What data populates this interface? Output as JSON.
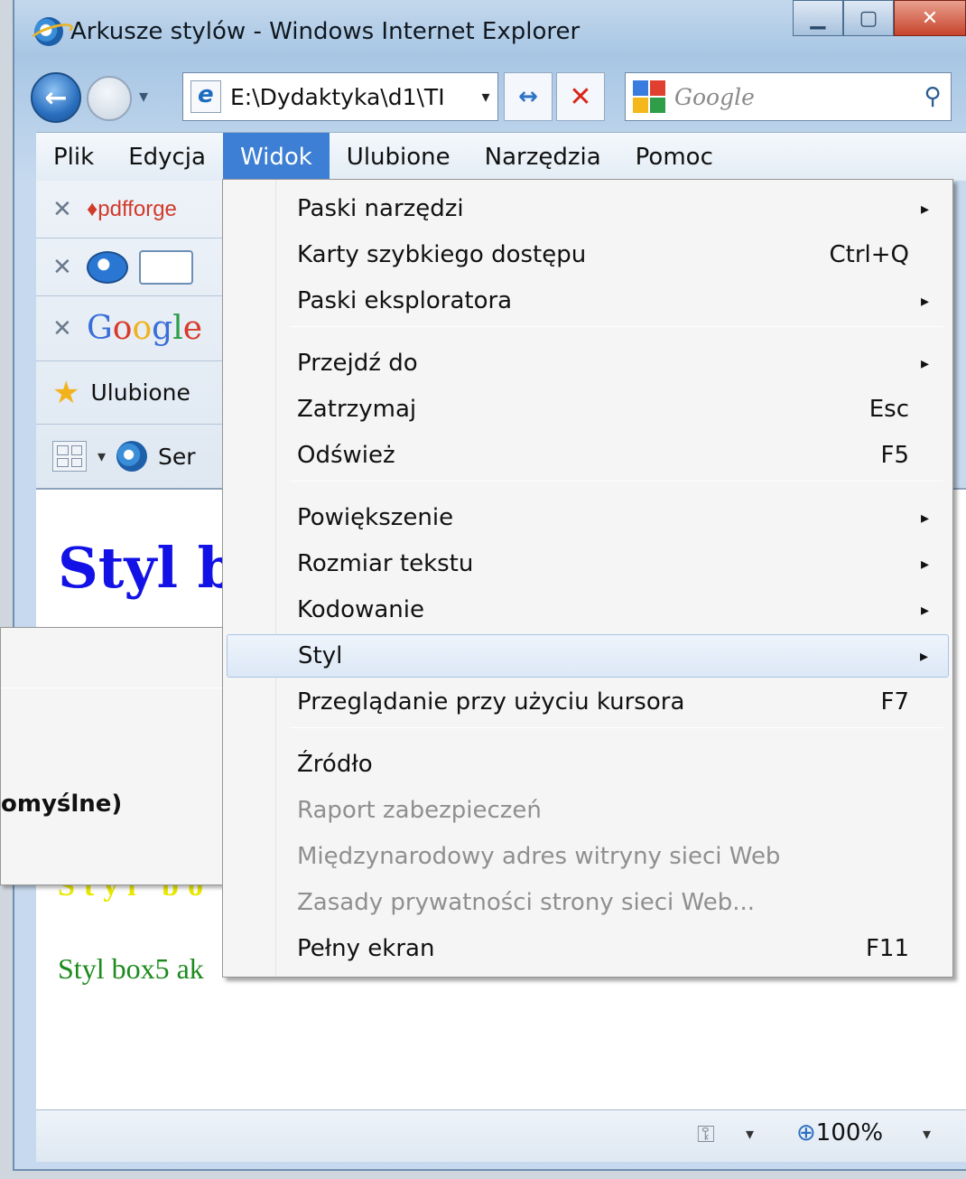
{
  "window": {
    "title": "Arkusze stylów - Windows Internet Explorer",
    "minimize_glyph": "▁",
    "maximize_glyph": "▢",
    "close_glyph": "✕"
  },
  "nav": {
    "address": "E:\\Dydaktyka\\d1\\TI",
    "search_placeholder": "Google",
    "back_glyph": "←",
    "dropdown_glyph": "▾",
    "go_glyph": "↔",
    "stop_glyph": "✕",
    "search_glyph": "⚲"
  },
  "menubar": {
    "items": [
      "Plik",
      "Edycja",
      "Widok",
      "Ulubione",
      "Narzędzia",
      "Pomoc"
    ],
    "active": "Widok"
  },
  "toolbars": {
    "close_glyph": "✕",
    "pdfforge": "pdfforge",
    "google": "Google",
    "favorites_label": "Ulubione",
    "tab_label": "Ser"
  },
  "content": {
    "heading_fragment": "Styl b",
    "yellow_fragment": "Styl bo",
    "green_fragment": "Styl box5 ak"
  },
  "status": {
    "zoom": "100%",
    "dropdown_glyph": "▾"
  },
  "widok_menu": {
    "items": [
      {
        "label": "Paski narzędzi",
        "shortcut": "",
        "submenu": true
      },
      {
        "label": "Karty szybkiego dostępu",
        "shortcut": "Ctrl+Q",
        "submenu": false
      },
      {
        "label": "Paski eksploratora",
        "shortcut": "",
        "submenu": true
      },
      {
        "label": "Przejdź do",
        "shortcut": "",
        "submenu": true
      },
      {
        "label": "Zatrzymaj",
        "shortcut": "Esc",
        "submenu": false
      },
      {
        "label": "Odśwież",
        "shortcut": "F5",
        "submenu": false
      },
      {
        "label": "Powiększenie",
        "shortcut": "",
        "submenu": true
      },
      {
        "label": "Rozmiar tekstu",
        "shortcut": "",
        "submenu": true
      },
      {
        "label": "Kodowanie",
        "shortcut": "",
        "submenu": true
      },
      {
        "label": "Styl",
        "shortcut": "",
        "submenu": true
      },
      {
        "label": "Przeglądanie przy użyciu kursora",
        "shortcut": "F7",
        "submenu": false
      },
      {
        "label": "Źródło",
        "shortcut": "",
        "submenu": false
      },
      {
        "label": "Raport zabezpieczeń",
        "shortcut": "",
        "submenu": false
      },
      {
        "label": "Międzynarodowy adres witryny sieci Web",
        "shortcut": "",
        "submenu": false
      },
      {
        "label": "Zasady prywatności strony sieci Web...",
        "shortcut": "",
        "submenu": false
      },
      {
        "label": "Pełny ekran",
        "shortcut": "F11",
        "submenu": false
      }
    ],
    "arrow_glyph": "▸",
    "highlighted": "Styl",
    "disabled": [
      "Raport zabezpieczeń",
      "Międzynarodowy adres witryny sieci Web",
      "Zasady prywatności strony sieci Web..."
    ]
  },
  "style_submenu": {
    "visible_item": "omyślne)"
  }
}
